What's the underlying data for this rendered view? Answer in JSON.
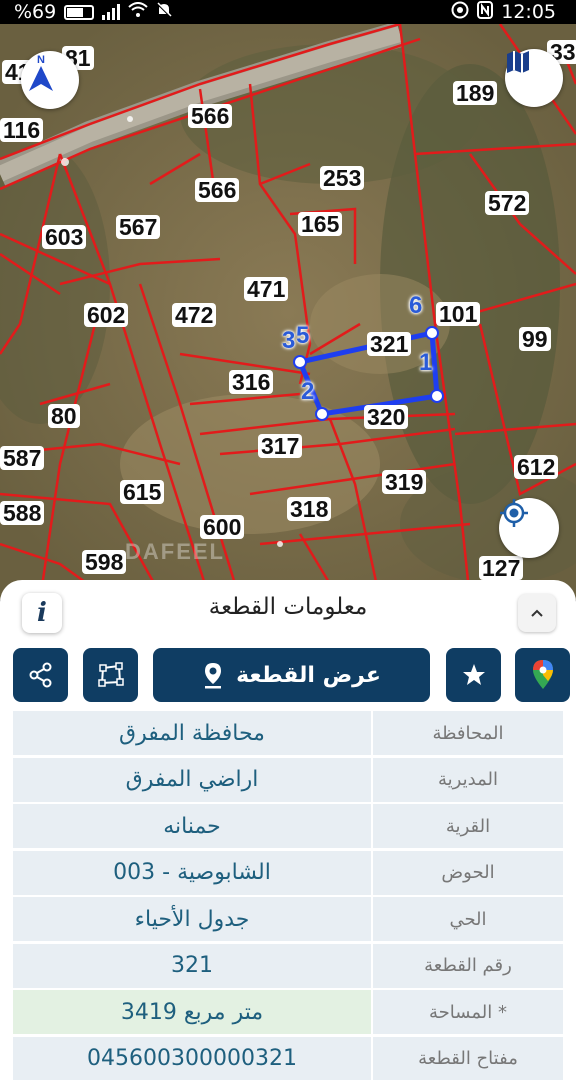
{
  "status": {
    "battery": "%69",
    "time": "12:05"
  },
  "map": {
    "parcel_labels": [
      "41",
      "81",
      "116",
      "566",
      "566",
      "253",
      "189",
      "33",
      "572",
      "567",
      "603",
      "165",
      "471",
      "472",
      "602",
      "101",
      "99",
      "321",
      "316",
      "80",
      "320",
      "317",
      "587",
      "615",
      "319",
      "612",
      "588",
      "600",
      "318",
      "598",
      "127"
    ],
    "vertex_labels": [
      "6",
      "5",
      "1",
      "2",
      "3"
    ],
    "watermark": "DAFEEL"
  },
  "sheet": {
    "title": "معلومات القطعة",
    "info_icon": "i",
    "show_parcel_label": "عرض القطعة"
  },
  "details": [
    {
      "key": "المحافظة",
      "value": "محافظة المفرق"
    },
    {
      "key": "المديرية",
      "value": "اراضي المفرق"
    },
    {
      "key": "القرية",
      "value": "حمنانه"
    },
    {
      "key": "الحوض",
      "value": "الشابوصية - 003"
    },
    {
      "key": "الحي",
      "value": "جدول الأحياء"
    },
    {
      "key": "رقم القطعة",
      "value": "321"
    },
    {
      "key": "المساحة *",
      "value": "3419  متر مربع"
    },
    {
      "key": "مفتاح القطعة",
      "value": "045600300000321"
    }
  ],
  "colors": {
    "accent": "#0f3d63",
    "parcel_lines": "#e21b1b",
    "selected_parcel": "#1e3ef0",
    "value_text": "#1e5f7e"
  }
}
